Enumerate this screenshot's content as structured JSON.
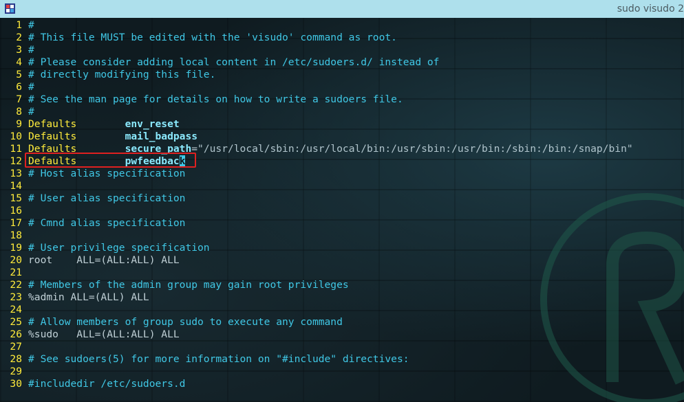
{
  "window": {
    "title": "sudo visudo 2"
  },
  "lines": [
    {
      "n": "1",
      "text": "#"
    },
    {
      "n": "2",
      "text": "# This file MUST be edited with the 'visudo' command as root."
    },
    {
      "n": "3",
      "text": "#"
    },
    {
      "n": "4",
      "text": "# Please consider adding local content in /etc/sudoers.d/ instead of"
    },
    {
      "n": "5",
      "text": "# directly modifying this file."
    },
    {
      "n": "6",
      "text": "#"
    },
    {
      "n": "7",
      "text": "# See the man page for details on how to write a sudoers file."
    },
    {
      "n": "8",
      "text": "#"
    },
    {
      "n": "9",
      "kw": "Defaults",
      "opt": "env_reset"
    },
    {
      "n": "10",
      "kw": "Defaults",
      "opt": "mail_badpass"
    },
    {
      "n": "11",
      "kw": "Defaults",
      "opt": "secure_path",
      "eq": "=",
      "str": "\"/usr/local/sbin:/usr/local/bin:/usr/sbin:/usr/bin:/sbin:/bin:/snap/bin\""
    },
    {
      "n": "12",
      "kw": "Defaults",
      "opt": "pwfeedbac",
      "cursor": "k"
    },
    {
      "n": "13",
      "text": "# Host alias specification"
    },
    {
      "n": "14",
      "text": ""
    },
    {
      "n": "15",
      "text": "# User alias specification"
    },
    {
      "n": "16",
      "text": ""
    },
    {
      "n": "17",
      "text": "# Cmnd alias specification"
    },
    {
      "n": "18",
      "text": ""
    },
    {
      "n": "19",
      "text": "# User privilege specification"
    },
    {
      "n": "20",
      "plain": "root    ALL=(ALL:ALL) ALL"
    },
    {
      "n": "21",
      "text": ""
    },
    {
      "n": "22",
      "text": "# Members of the admin group may gain root privileges"
    },
    {
      "n": "23",
      "plain": "%admin ALL=(ALL) ALL"
    },
    {
      "n": "24",
      "text": ""
    },
    {
      "n": "25",
      "text": "# Allow members of group sudo to execute any command"
    },
    {
      "n": "26",
      "plain": "%sudo   ALL=(ALL:ALL) ALL"
    },
    {
      "n": "27",
      "text": ""
    },
    {
      "n": "28",
      "text": "# See sudoers(5) for more information on \"#include\" directives:"
    },
    {
      "n": "29",
      "text": ""
    },
    {
      "n": "30",
      "text": "#includedir /etc/sudoers.d"
    }
  ],
  "colors": {
    "comment": "#40c8e6",
    "keyword": "#ffeb3b",
    "option": "#8be9fd",
    "highlight": "#e02020"
  },
  "icons": {
    "app": "terminal-app-icon"
  }
}
